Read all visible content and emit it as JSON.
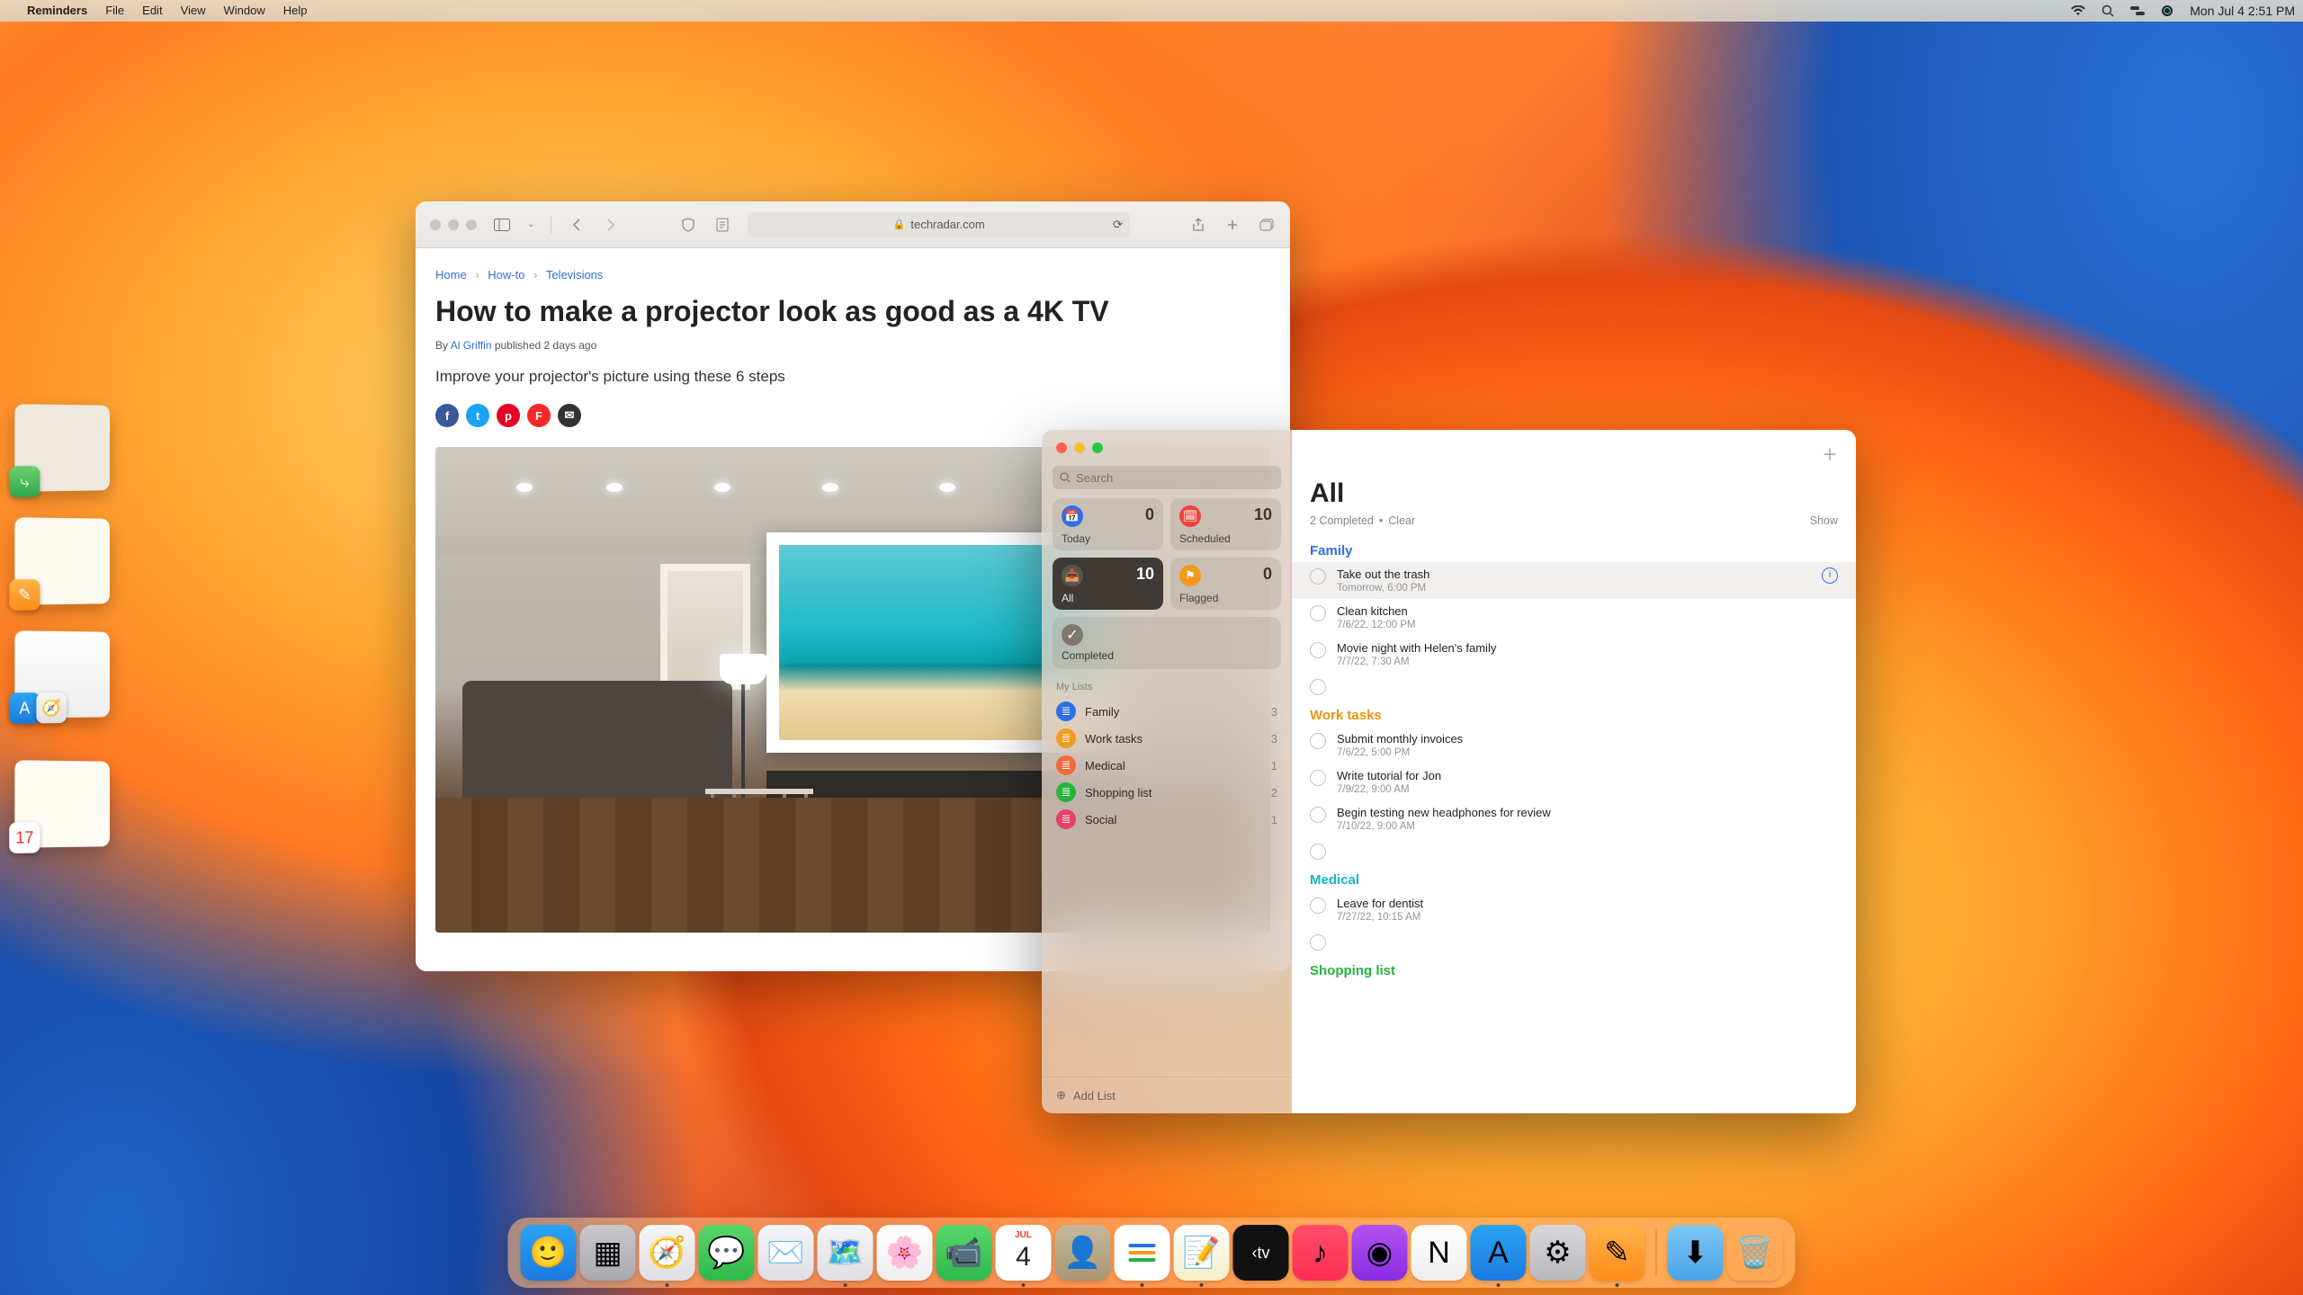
{
  "menubar": {
    "app_name": "Reminders",
    "menus": [
      "File",
      "Edit",
      "View",
      "Window",
      "Help"
    ],
    "clock": "Mon Jul 4  2:51 PM"
  },
  "safari": {
    "url_host": "techradar.com",
    "breadcrumbs": {
      "home": "Home",
      "howto": "How-to",
      "tv": "Televisions"
    },
    "article_title": "How to make a projector look as good as a 4K TV",
    "byline_prefix": "By ",
    "author": "Al Griffin",
    "published": " published 2 days ago",
    "deck": "Improve your projector's picture using these 6 steps"
  },
  "reminders": {
    "search_placeholder": "Search",
    "smart": {
      "today": {
        "label": "Today",
        "count": "0",
        "color": "#2f6fe6"
      },
      "scheduled": {
        "label": "Scheduled",
        "count": "10",
        "color": "#ef413a"
      },
      "all": {
        "label": "All",
        "count": "10",
        "color": "#3f3a36"
      },
      "flagged": {
        "label": "Flagged",
        "count": "0",
        "color": "#f29b1d"
      }
    },
    "completed_label": "Completed",
    "mylists_label": "My Lists",
    "lists": [
      {
        "name": "Family",
        "count": "3",
        "color": "#2f6fe6"
      },
      {
        "name": "Work tasks",
        "count": "3",
        "color": "#f29b1d"
      },
      {
        "name": "Medical",
        "count": "1",
        "color": "#f46a3c"
      },
      {
        "name": "Shopping list",
        "count": "2",
        "color": "#28b33d"
      },
      {
        "name": "Social",
        "count": "1",
        "color": "#e83e6a"
      }
    ],
    "add_list_label": "Add List",
    "detail": {
      "title": "All",
      "completed_text": "2 Completed",
      "clear": "Clear",
      "show": "Show",
      "groups": [
        {
          "name": "Family",
          "class": "gt-family",
          "items": [
            {
              "title": "Take out the trash",
              "sub": "Tomorrow, 6:00 PM",
              "selected": true
            },
            {
              "title": "Clean kitchen",
              "sub": "7/6/22, 12:00 PM"
            },
            {
              "title": "Movie night with Helen's family",
              "sub": "7/7/22, 7:30 AM"
            },
            {
              "title": "",
              "sub": ""
            }
          ]
        },
        {
          "name": "Work tasks",
          "class": "gt-work",
          "items": [
            {
              "title": "Submit monthly invoices",
              "sub": "7/6/22, 5:00 PM"
            },
            {
              "title": "Write tutorial for Jon",
              "sub": "7/9/22, 9:00 AM"
            },
            {
              "title": "Begin testing new headphones for review",
              "sub": "7/10/22, 9:00 AM"
            },
            {
              "title": "",
              "sub": ""
            }
          ]
        },
        {
          "name": "Medical",
          "class": "gt-medical",
          "items": [
            {
              "title": "Leave for dentist",
              "sub": "7/27/22, 10:15 AM"
            },
            {
              "title": "",
              "sub": ""
            }
          ]
        },
        {
          "name": "Shopping list",
          "class": "gt-shopping",
          "items": []
        }
      ]
    }
  },
  "dock": {
    "apps": [
      {
        "name": "finder",
        "bg": "linear-gradient(#2aa4f4,#1b7ae0)",
        "glyph": "🙂",
        "running": false
      },
      {
        "name": "launchpad",
        "bg": "linear-gradient(#c8c8cc,#a8a8ae)",
        "glyph": "▦",
        "running": false
      },
      {
        "name": "safari",
        "bg": "linear-gradient(#f6f6f8,#dedee2)",
        "glyph": "🧭",
        "running": true
      },
      {
        "name": "messages",
        "bg": "linear-gradient(#58d66b,#2fb84a)",
        "glyph": "💬",
        "running": false
      },
      {
        "name": "mail",
        "bg": "linear-gradient(#f6f6f8,#dedee2)",
        "glyph": "✉️",
        "running": false
      },
      {
        "name": "maps",
        "bg": "linear-gradient(#f6f6f8,#dedee2)",
        "glyph": "🗺️",
        "running": true
      },
      {
        "name": "photos",
        "bg": "linear-gradient(#fff,#eee)",
        "glyph": "🌸",
        "running": false
      },
      {
        "name": "facetime",
        "bg": "linear-gradient(#58d66b,#2fb84a)",
        "glyph": "📹",
        "running": false
      },
      {
        "name": "calendar",
        "bg": "#fff",
        "glyph": "4",
        "running": true
      },
      {
        "name": "contacts",
        "bg": "linear-gradient(#c7b79a,#a89676)",
        "glyph": "👤",
        "running": false
      },
      {
        "name": "reminders",
        "bg": "#fff",
        "glyph": "≣",
        "running": true
      },
      {
        "name": "notes",
        "bg": "linear-gradient(#fff,#f6eec7)",
        "glyph": "📝",
        "running": true
      },
      {
        "name": "tv",
        "bg": "#111",
        "glyph": "tv",
        "running": false
      },
      {
        "name": "music",
        "bg": "linear-gradient(#ff4d6a,#ff2d55)",
        "glyph": "♪",
        "running": false
      },
      {
        "name": "podcasts",
        "bg": "linear-gradient(#b453f2,#8a2be2)",
        "glyph": "◉",
        "running": false
      },
      {
        "name": "news",
        "bg": "linear-gradient(#fff,#eee)",
        "glyph": "N",
        "running": false
      },
      {
        "name": "appstore",
        "bg": "linear-gradient(#2aa4f4,#1b7ae0)",
        "glyph": "A",
        "running": true
      },
      {
        "name": "settings",
        "bg": "linear-gradient(#d8d8dc,#b8b8bc)",
        "glyph": "⚙︎",
        "running": false
      },
      {
        "name": "pages",
        "bg": "linear-gradient(#ffb347,#ff8c1a)",
        "glyph": "✎",
        "running": true
      }
    ],
    "right": [
      {
        "name": "downloads",
        "bg": "linear-gradient(#7dc7f6,#4aa3e6)",
        "glyph": "⬇︎"
      },
      {
        "name": "trash",
        "bg": "transparent",
        "glyph": "🗑️"
      }
    ]
  }
}
